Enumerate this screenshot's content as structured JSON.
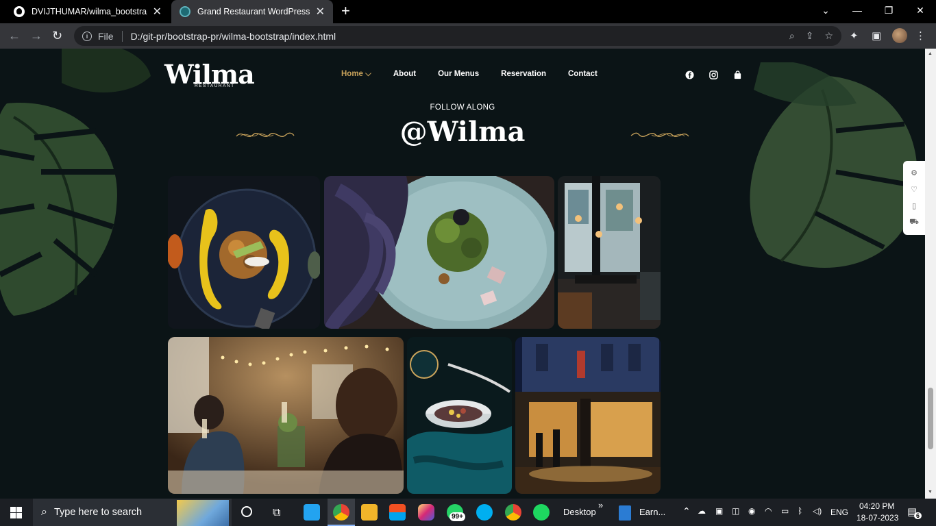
{
  "browser": {
    "tabs": [
      {
        "title": "DVIJTHUMAR/wilma_bootstrap",
        "close": "✕"
      },
      {
        "title": "Grand Restaurant WordPress The",
        "close": "✕"
      }
    ],
    "new_tab": "+",
    "window_controls": {
      "minimize": "⌄",
      "restore": "—",
      "maximize": "❐",
      "close": "✕"
    },
    "omnibox": {
      "scheme_label": "File",
      "url": "D:/git-pr/bootstrap-pr/wilma-bootstrap/index.html"
    }
  },
  "site": {
    "logo": "Wilma",
    "logo_sub": "RESTAURANT",
    "nav": [
      {
        "label": "Home ⌵",
        "active": true
      },
      {
        "label": "About"
      },
      {
        "label": "Our Menus"
      },
      {
        "label": "Reservation"
      },
      {
        "label": "Contact"
      }
    ],
    "socials": [
      "facebook-icon",
      "instagram-icon",
      "bag-icon"
    ],
    "follow_label": "FOLLOW ALONG",
    "handle": "@Wilma",
    "gallery": [
      "plated-dish-yellow-sauce",
      "salad-on-speckled-plate",
      "restaurant-window-interior",
      "dining-hall-toast",
      "bowl-on-teal-napkin",
      "kadoya-street-corner"
    ]
  },
  "side_widget": [
    "gear-icon",
    "heart-icon",
    "book-icon",
    "cart-icon"
  ],
  "taskbar": {
    "search_placeholder": "Type here to search",
    "whatsapp_badge": "99+",
    "desktop_label": "Desktop",
    "chevron": "»",
    "earn_label": "Earn...",
    "lang": "ENG",
    "time": "04:20 PM",
    "date": "18-07-2023",
    "notif_count": "6"
  },
  "colors": {
    "accent_gold": "#c9a35b",
    "page_bg": "#0b1416",
    "chrome_bg": "#35363a"
  }
}
